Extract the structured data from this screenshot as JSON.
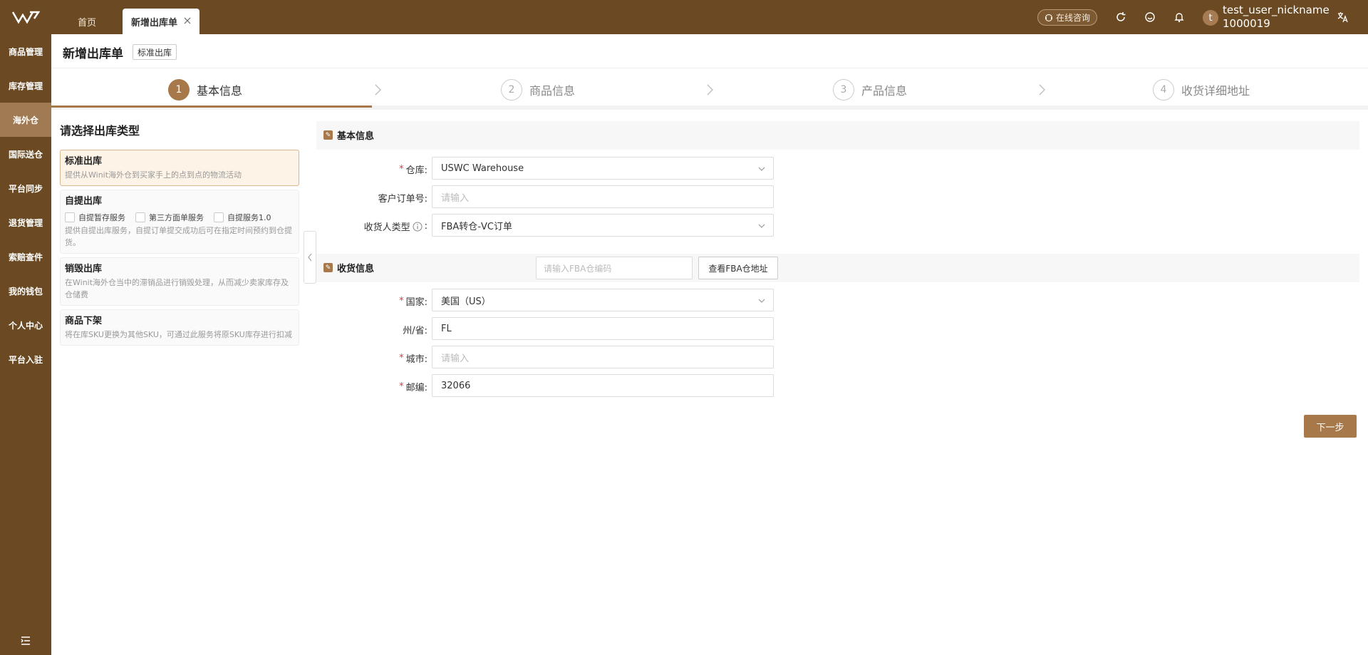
{
  "topbar": {
    "home_tab": "首页",
    "active_tab": "新增出库单",
    "consult": "在线咨询",
    "username": "test_user_nickname",
    "user_id": "1000019",
    "avatar_letter": "t"
  },
  "sidebar": {
    "items": [
      {
        "label": "商品管理"
      },
      {
        "label": "库存管理"
      },
      {
        "label": "海外仓"
      },
      {
        "label": "国际送仓"
      },
      {
        "label": "平台同步"
      },
      {
        "label": "退货管理"
      },
      {
        "label": "索赔查件"
      },
      {
        "label": "我的钱包"
      },
      {
        "label": "个人中心"
      },
      {
        "label": "平台入驻"
      }
    ],
    "active_index": 2
  },
  "header": {
    "title": "新增出库单",
    "tag": "标准出库"
  },
  "steps": [
    {
      "num": "1",
      "label": "基本信息"
    },
    {
      "num": "2",
      "label": "商品信息"
    },
    {
      "num": "3",
      "label": "产品信息"
    },
    {
      "num": "4",
      "label": "收货详细地址"
    }
  ],
  "left": {
    "title": "请选择出库类型",
    "types": [
      {
        "name": "标准出库",
        "desc": "提供从Winit海外仓到买家手上的点到点的物流活动"
      },
      {
        "name": "自提出库",
        "desc": "提供自提出库服务，自提订单提交成功后可在指定时间预约到仓提货。",
        "options": [
          "自提暂存服务",
          "第三方面单服务",
          "自提服务1.0"
        ]
      },
      {
        "name": "销毁出库",
        "desc": "在Winit海外仓当中的滞销品进行销毁处理，从而减少卖家库存及仓储费"
      },
      {
        "name": "商品下架",
        "desc": "将在库SKU更换为其他SKU，可通过此服务将原SKU库存进行扣减"
      }
    ]
  },
  "basic": {
    "section_title": "基本信息",
    "warehouse_label": "仓库:",
    "warehouse_value": "USWC Warehouse",
    "order_label": "客户订单号:",
    "order_placeholder": "请输入",
    "consignee_label": "收货人类型",
    "consignee_value": "FBA转仓-VC订单"
  },
  "receive": {
    "section_title": "收货信息",
    "fba_placeholder": "请输入FBA仓编码",
    "fba_button": "查看FBA仓地址",
    "country_label": "国家:",
    "country_value": "美国（US）",
    "state_label": "州/省:",
    "state_value": "FL",
    "city_label": "城市:",
    "city_placeholder": "请输入",
    "zip_label": "邮编:",
    "zip_value": "32066"
  },
  "actions": {
    "next": "下一步"
  },
  "colors": {
    "brand": "#6b4a23",
    "accent": "#a7794a"
  }
}
